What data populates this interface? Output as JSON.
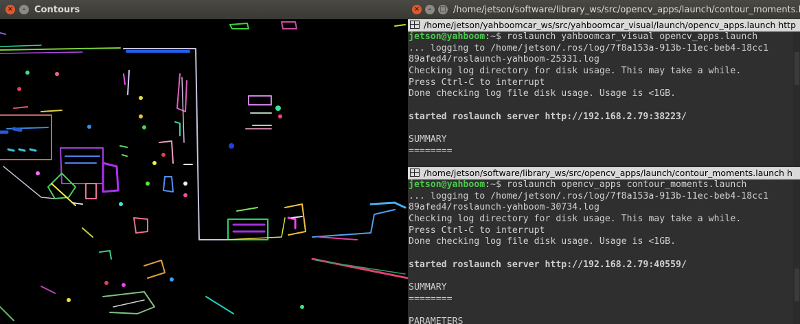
{
  "contours_window": {
    "title": "Contours",
    "buttons": {
      "close": "×",
      "min": "–",
      "max": "□"
    }
  },
  "terminal_window": {
    "title": "/home/jetson/software/library_ws/src/opencv_apps/launch/contour_moments.launch",
    "buttons": {
      "close": "×",
      "min": "–",
      "max": "□"
    },
    "panes": [
      {
        "tab_title": "/home/jetson/yahboomcar_ws/src/yahboomcar_visual/launch/opencv_apps.launch http",
        "prompt_user": "jetson@yahboom",
        "prompt_rest": ":~$ roslaunch yahboomcar_visual opencv_apps.launch",
        "lines": [
          "... logging to /home/jetson/.ros/log/7f8a153a-913b-11ec-beb4-18cc1",
          "89afed4/roslaunch-yahboom-25331.log",
          "Checking log directory for disk usage. This may take a while.",
          "Press Ctrl-C to interrupt",
          "Done checking log file disk usage. Usage is <1GB.",
          "",
          "started roslaunch server http://192.168.2.79:38223/",
          "",
          "SUMMARY",
          "========"
        ]
      },
      {
        "tab_title": "/home/jetson/software/library_ws/src/opencv_apps/launch/contour_moments.launch h",
        "prompt_user": "jetson@yahboom",
        "prompt_rest": ":~$ roslaunch opencv_apps contour_moments.launch",
        "lines": [
          "... logging to /home/jetson/.ros/log/7f8a153a-913b-11ec-beb4-18cc1",
          "89afed4/roslaunch-yahboom-30734.log",
          "Checking log directory for disk usage. This may take a while.",
          "Press Ctrl-C to interrupt",
          "Done checking log file disk usage. Usage is <1GB.",
          "",
          "started roslaunch server http://192.168.2.79:40559/",
          "",
          "SUMMARY",
          "========",
          "",
          "PARAMETERS"
        ]
      }
    ]
  },
  "colors": {
    "prompt_green": "#4ec94e",
    "terminal_text": "#d0d0d0",
    "terminal_bg": "#2f2f2f",
    "close_button": "#e0592c"
  }
}
